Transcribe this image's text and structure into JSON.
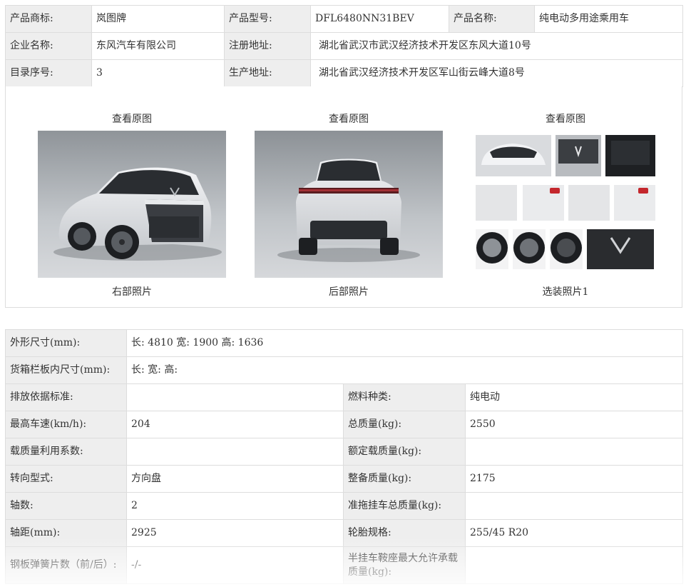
{
  "product": {
    "brand_label": "产品商标:",
    "brand": "岚图牌",
    "model_label": "产品型号:",
    "model": "DFL6480NN31BEV",
    "name_label": "产品名称:",
    "name": "纯电动多用途乘用车",
    "company_label": "企业名称:",
    "company": "东风汽车有限公司",
    "reg_addr_label": "注册地址:",
    "reg_addr": "湖北省武汉市武汉经济技术开发区东风大道10号",
    "catalog_label": "目录序号:",
    "catalog": "3",
    "prod_addr_label": "生产地址:",
    "prod_addr": "湖北省武汉经济技术开发区军山街云峰大道8号"
  },
  "photos": [
    {
      "link": "查看原图",
      "caption": "右部照片"
    },
    {
      "link": "查看原图",
      "caption": "后部照片"
    },
    {
      "link": "查看原图",
      "caption": "选装照片1"
    }
  ],
  "specs": {
    "dims_label": "外形尺寸(mm):",
    "dims": "长: 4810 宽: 1900 高: 1636",
    "cargo_label": "货箱栏板内尺寸(mm):",
    "cargo": "长:  宽:  高:",
    "rows": [
      {
        "l1": "排放依据标准:",
        "v1": "",
        "l2": "燃料种类:",
        "v2": "纯电动"
      },
      {
        "l1": "最高车速(km/h):",
        "v1": "204",
        "l2": "总质量(kg):",
        "v2": "2550"
      },
      {
        "l1": "载质量利用系数:",
        "v1": "",
        "l2": "额定载质量(kg):",
        "v2": ""
      },
      {
        "l1": "转向型式:",
        "v1": "方向盘",
        "l2": "整备质量(kg):",
        "v2": "2175"
      },
      {
        "l1": "轴数:",
        "v1": "2",
        "l2": "准拖挂车总质量(kg):",
        "v2": ""
      },
      {
        "l1": "轴距(mm):",
        "v1": "2925",
        "l2": "轮胎规格:",
        "v2": "255/45 R20"
      },
      {
        "l1": "钢板弹簧片数（前/后）:",
        "v1": "-/-",
        "l2": "半挂车鞍座最大允许承载质量(kg):",
        "v2": ""
      }
    ]
  }
}
